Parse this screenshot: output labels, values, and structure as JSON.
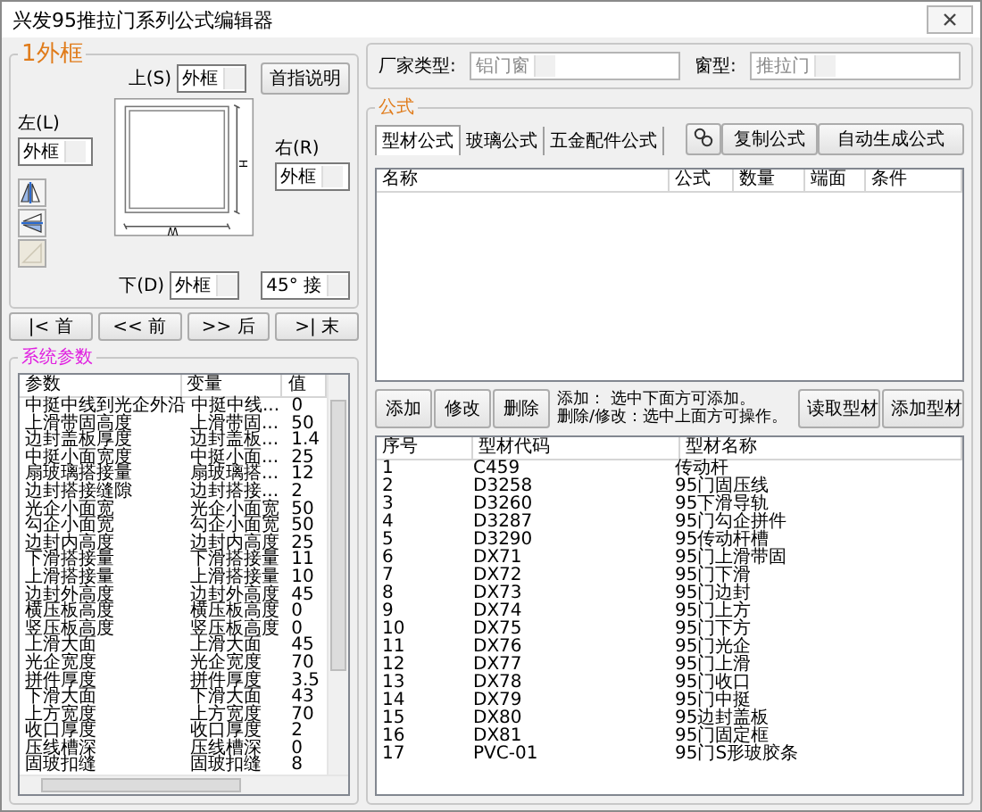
{
  "window": {
    "title": "兴发95推拉门系列公式编辑器"
  },
  "frame_panel": {
    "title": "1外框",
    "top": {
      "label": "上(S)",
      "value": "外框"
    },
    "help_button": "首指说明",
    "left": {
      "label": "左(L)",
      "value": "外框"
    },
    "right": {
      "label": "右(R)",
      "value": "外框"
    },
    "bottom": {
      "label": "下(D)",
      "value": "外框"
    },
    "joint": {
      "value": "45° 接"
    },
    "dims": {
      "height": "H",
      "width": "W"
    },
    "tools": [
      {
        "disabled": false
      },
      {
        "disabled": false
      },
      {
        "disabled": true
      }
    ]
  },
  "nav_buttons": [
    "|< 首",
    "<< 前",
    ">> 后",
    ">| 末"
  ],
  "params": {
    "title": "系统参数",
    "columns": [
      "参数",
      "变量",
      "值"
    ],
    "rows": [
      [
        "中挺中线到光企外沿",
        "中挺中线...",
        "0"
      ],
      [
        "上滑带固高度",
        "上滑带固...",
        "50"
      ],
      [
        "边封盖板厚度",
        "边封盖板...",
        "1.4"
      ],
      [
        "中挺小面宽度",
        "中挺小面...",
        "25"
      ],
      [
        "扇玻璃搭接量",
        "扇玻璃搭...",
        "12"
      ],
      [
        "边封搭接缝隙",
        "边封搭接...",
        "2"
      ],
      [
        "光企小面宽",
        "光企小面宽",
        "50"
      ],
      [
        "勾企小面宽",
        "勾企小面宽",
        "50"
      ],
      [
        "边封内高度",
        "边封内高度",
        "25"
      ],
      [
        "下滑搭接量",
        "下滑搭接量",
        "11"
      ],
      [
        "上滑搭接量",
        "上滑搭接量",
        "10"
      ],
      [
        "边封外高度",
        "边封外高度",
        "45"
      ],
      [
        "横压板高度",
        "横压板高度",
        "0"
      ],
      [
        "竖压板高度",
        "竖压板高度",
        "0"
      ],
      [
        "上滑大面",
        "上滑大面",
        "45"
      ],
      [
        "光企宽度",
        "光企宽度",
        "70"
      ],
      [
        "拼件厚度",
        "拼件厚度",
        "3.5"
      ],
      [
        "下滑大面",
        "下滑大面",
        "43"
      ],
      [
        "上方宽度",
        "上方宽度",
        "70"
      ],
      [
        "收口厚度",
        "收口厚度",
        "2"
      ],
      [
        "压线槽深",
        "压线槽深",
        "0"
      ],
      [
        "固玻扣缝",
        "固玻扣缝",
        "8"
      ]
    ]
  },
  "filters": [
    {
      "label": "厂家类型:",
      "value": "铝门窗",
      "disabled": true
    },
    {
      "label": "窗型:",
      "value": "推拉门",
      "disabled": true
    }
  ],
  "formula": {
    "title": "公式",
    "tabs": [
      {
        "label": "型材公式",
        "selected": true
      },
      {
        "label": "玻璃公式",
        "selected": false
      },
      {
        "label": "五金配件公式",
        "selected": false
      }
    ],
    "copy_button": "复制公式",
    "auto_button": "自动生成公式",
    "columns": [
      "名称",
      "公式",
      "数量",
      "端面",
      "条件"
    ],
    "actions": [
      "添加",
      "修改",
      "删除"
    ],
    "hint_lines": [
      "添加：  选中下面方可添加。",
      "删除/修改：选中上面方可操作。"
    ],
    "profile_buttons": [
      "读取型材",
      "添加型材"
    ],
    "profiles": {
      "columns": [
        "序号",
        "型材代码",
        "型材名称"
      ],
      "rows": [
        [
          "1",
          "C459",
          "传动杆"
        ],
        [
          "2",
          "D3258",
          "95门固压线"
        ],
        [
          "3",
          "D3260",
          "95下滑导轨"
        ],
        [
          "4",
          "D3287",
          "95门勾企拼件"
        ],
        [
          "5",
          "D3290",
          "95传动杆槽"
        ],
        [
          "6",
          "DX71",
          "95门上滑带固"
        ],
        [
          "7",
          "DX72",
          "95门下滑"
        ],
        [
          "8",
          "DX73",
          "95门边封"
        ],
        [
          "9",
          "DX74",
          "95门上方"
        ],
        [
          "10",
          "DX75",
          "95门下方"
        ],
        [
          "11",
          "DX76",
          "95门光企"
        ],
        [
          "12",
          "DX77",
          "95门上滑"
        ],
        [
          "13",
          "DX78",
          "95门收口"
        ],
        [
          "14",
          "DX79",
          "95门中挺"
        ],
        [
          "15",
          "DX80",
          "95边封盖板"
        ],
        [
          "16",
          "DX81",
          "95门固定框"
        ],
        [
          "17",
          "PVC-01",
          "95门S形玻胶条"
        ]
      ]
    }
  }
}
